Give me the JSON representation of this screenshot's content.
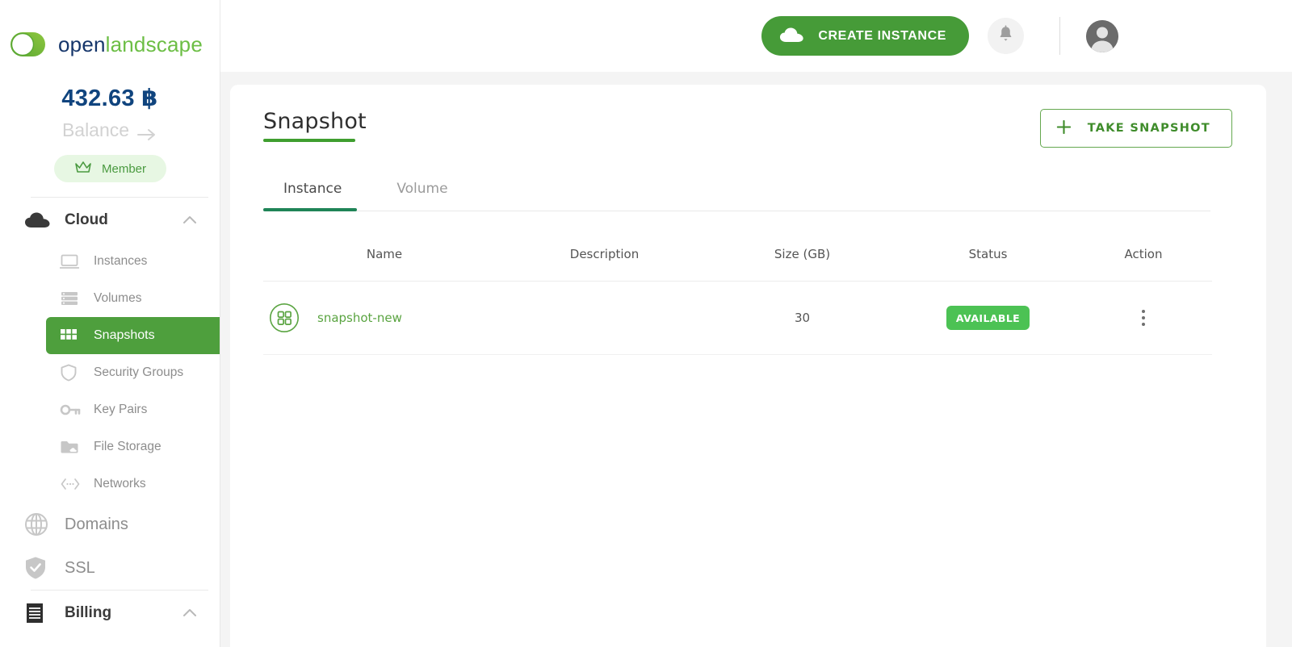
{
  "brand": {
    "logo_text_dark": "open",
    "logo_text_light": "landscape",
    "logo_icon": "openlandscape-logo-icon",
    "color_dark": "#16366b",
    "color_light": "#6cbe45"
  },
  "sidebar": {
    "balance": {
      "amount": "432.63 ฿",
      "label": "Balance",
      "arrow_icon": "arrow-right-icon"
    },
    "membership": {
      "label": "Member",
      "icon": "crown-icon",
      "bg_color": "#e7f7e3",
      "text_color": "#4a9a40"
    },
    "groups": [
      {
        "label": "Cloud",
        "icon": "cloud-icon",
        "chevron": "chevron-up-icon",
        "expanded": true,
        "items": [
          {
            "label": "Instances",
            "icon": "monitor-icon",
            "active": false
          },
          {
            "label": "Volumes",
            "icon": "storage-list-icon",
            "active": false
          },
          {
            "label": "Snapshots",
            "icon": "grid-icon",
            "active": true
          },
          {
            "label": "Security Groups",
            "icon": "shield-icon",
            "active": false
          },
          {
            "label": "Key Pairs",
            "icon": "key-icon",
            "active": false
          },
          {
            "label": "File Storage",
            "icon": "folder-cloud-icon",
            "active": false
          },
          {
            "label": "Networks",
            "icon": "network-nodes-icon",
            "active": false
          }
        ]
      },
      {
        "label": "Domains",
        "icon": "globe-icon",
        "chevron": null,
        "expanded": false,
        "items": []
      },
      {
        "label": "SSL",
        "icon": "shield-check-icon",
        "chevron": null,
        "expanded": false,
        "items": []
      },
      {
        "label": "Billing",
        "icon": "receipt-icon",
        "chevron": "chevron-up-icon",
        "expanded": true,
        "items": []
      }
    ],
    "active_color": "#4e9f3d"
  },
  "topbar": {
    "create_instance": {
      "label": "CREATE INSTANCE",
      "icon": "cloud-icon",
      "bg_color": "#469b38"
    },
    "notifications": {
      "icon": "bell-icon"
    },
    "account": {
      "icon": "user-avatar-icon"
    }
  },
  "main": {
    "title": "Snapshot",
    "take_snapshot": {
      "label": "TAKE SNAPSHOT",
      "icon": "plus-icon",
      "border_color": "#65a84f",
      "text_color": "#3f8c2b"
    },
    "tabs": [
      {
        "label": "Instance",
        "active": true
      },
      {
        "label": "Volume",
        "active": false
      }
    ],
    "table": {
      "columns": [
        "Name",
        "Description",
        "Size (GB)",
        "Status",
        "Action"
      ],
      "rows": [
        {
          "icon": "snapshot-grid-icon",
          "name": "snapshot-new",
          "description": "",
          "size": "30",
          "status": "AVAILABLE",
          "status_color": "#4cc254",
          "action_icon": "kebab-menu-icon"
        }
      ]
    }
  }
}
